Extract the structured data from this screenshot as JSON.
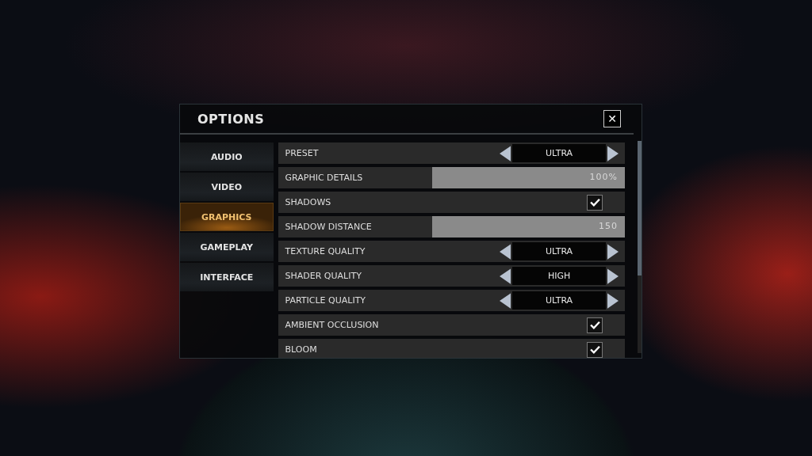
{
  "dialog": {
    "title": "OPTIONS",
    "close": "✕"
  },
  "sidebar": {
    "items": [
      {
        "label": "AUDIO",
        "selected": false
      },
      {
        "label": "VIDEO",
        "selected": false
      },
      {
        "label": "GRAPHICS",
        "selected": true
      },
      {
        "label": "GAMEPLAY",
        "selected": false
      },
      {
        "label": "INTERFACE",
        "selected": false
      }
    ]
  },
  "settings": [
    {
      "kind": "selector",
      "label": "PRESET",
      "value": "ULTRA"
    },
    {
      "kind": "slider",
      "label": "GRAPHIC DETAILS",
      "level": 1,
      "reading": "100%"
    },
    {
      "kind": "checkbox",
      "label": "SHADOWS",
      "checked": true
    },
    {
      "kind": "slider",
      "label": "SHADOW DISTANCE",
      "level": 1,
      "reading": "150"
    },
    {
      "kind": "selector",
      "label": "TEXTURE QUALITY",
      "value": "ULTRA"
    },
    {
      "kind": "selector",
      "label": "SHADER QUALITY",
      "value": "HIGH"
    },
    {
      "kind": "selector",
      "label": "PARTICLE QUALITY",
      "value": "ULTRA"
    },
    {
      "kind": "checkbox",
      "label": "AMBIENT OCCLUSION",
      "checked": true
    },
    {
      "kind": "checkbox",
      "label": "BLOOM",
      "checked": true
    }
  ]
}
